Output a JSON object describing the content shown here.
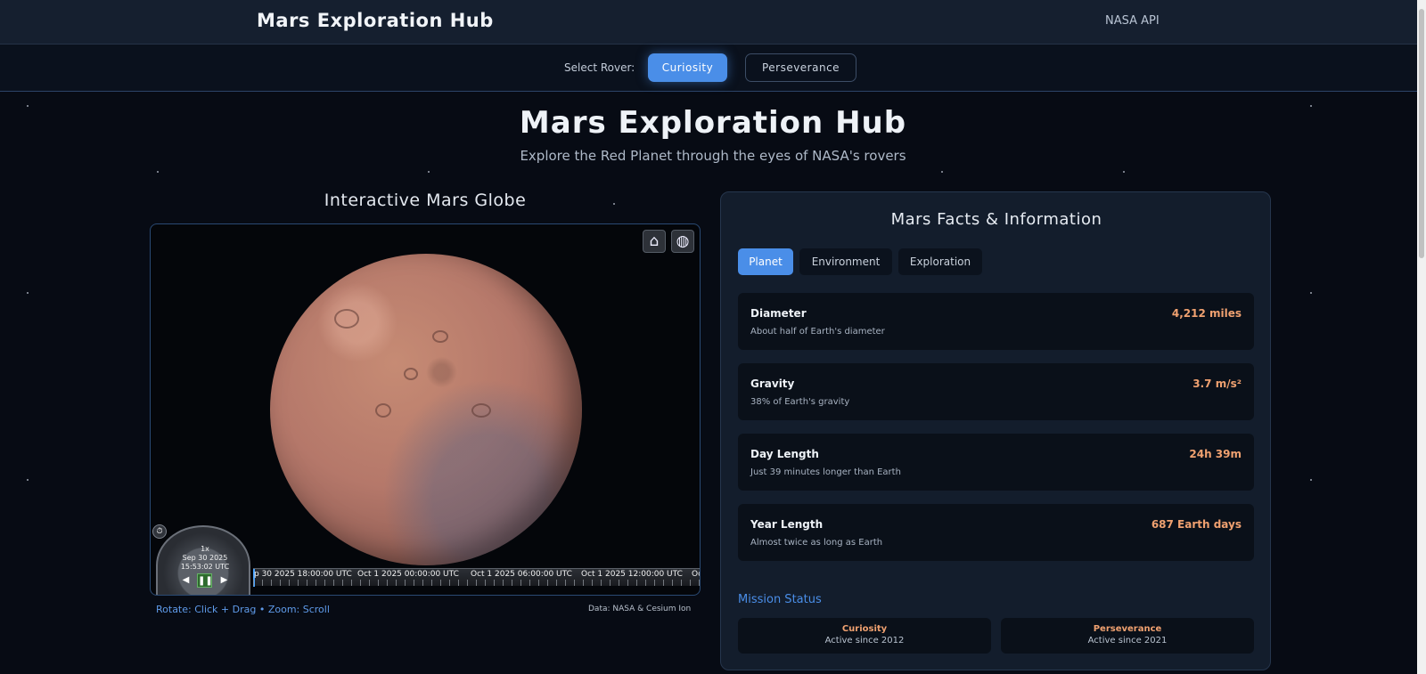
{
  "header": {
    "brand": "Mars Exploration Hub",
    "api_link": "NASA API"
  },
  "rover_selector": {
    "label": "Select Rover:",
    "rovers": [
      "Curiosity",
      "Perseverance"
    ],
    "selected": "Curiosity"
  },
  "hero": {
    "title": "Mars Exploration Hub",
    "subtitle": "Explore the Red Planet through the eyes of NASA's rovers"
  },
  "globe": {
    "title": "Interactive Mars Globe",
    "home_icon": "home-icon",
    "projection_icon": "globe-icon",
    "clock": {
      "speed": "1x",
      "date": "Sep 30 2025",
      "time": "15:53:02 UTC"
    },
    "timeline": [
      "p 30 2025 18:00:00 UTC",
      "Oct 1 2025 00:00:00 UTC",
      "Oct 1 2025 06:00:00 UTC",
      "Oct 1 2025 12:00:00 UTC",
      "Oc"
    ],
    "hint": "Rotate: Click + Drag • Zoom: Scroll",
    "credit": "Data: NASA & Cesium Ion"
  },
  "facts": {
    "title": "Mars Facts & Information",
    "tabs": [
      "Planet",
      "Environment",
      "Exploration"
    ],
    "active_tab": "Planet",
    "items": [
      {
        "label": "Diameter",
        "desc": "About half of Earth's diameter",
        "value": "4,212 miles"
      },
      {
        "label": "Gravity",
        "desc": "38% of Earth's gravity",
        "value": "3.7 m/s²"
      },
      {
        "label": "Day Length",
        "desc": "Just 39 minutes longer than Earth",
        "value": "24h 39m"
      },
      {
        "label": "Year Length",
        "desc": "Almost twice as long as Earth",
        "value": "687 Earth days"
      }
    ],
    "mission": {
      "title": "Mission Status",
      "rovers": [
        {
          "name": "Curiosity",
          "status": "Active since 2012"
        },
        {
          "name": "Perseverance",
          "status": "Active since 2021"
        }
      ]
    }
  },
  "colors": {
    "accent": "#4a8ee8",
    "value": "#f0a170",
    "background": "#070b14"
  }
}
